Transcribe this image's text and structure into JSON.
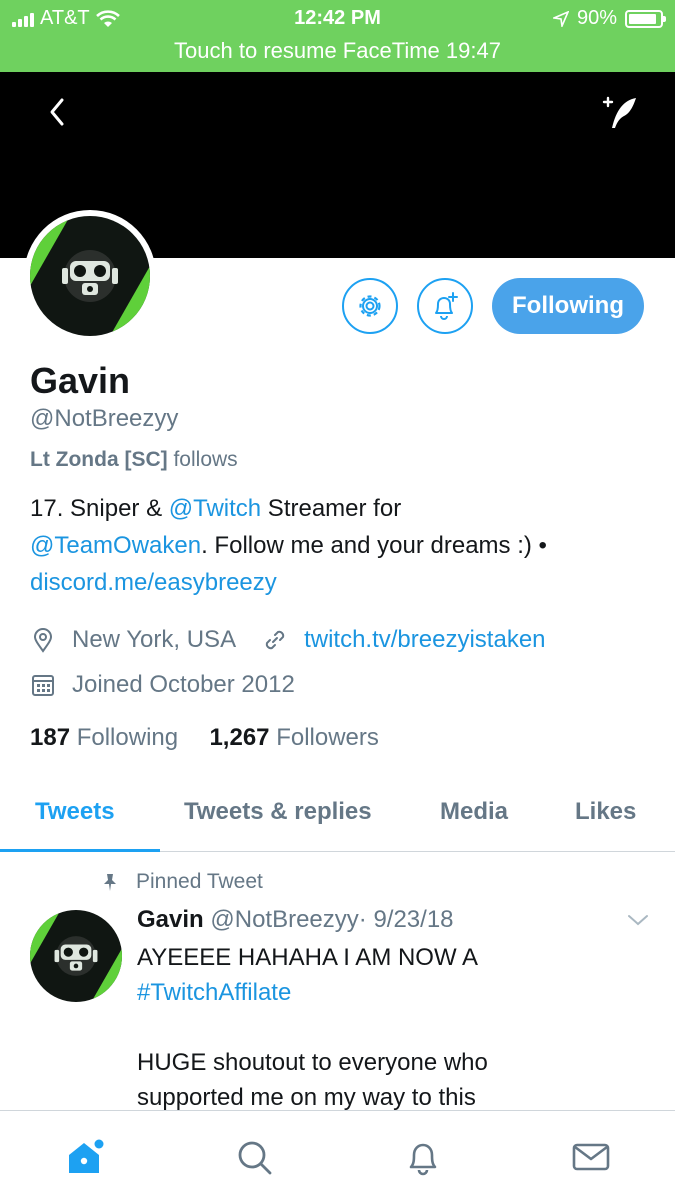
{
  "status": {
    "carrier": "AT&T",
    "time": "12:42 PM",
    "battery": "90%",
    "battery_level": 0.9,
    "facetime": "Touch to resume FaceTime 19:47"
  },
  "profile": {
    "name": "Gavin",
    "handle": "@NotBreezyy",
    "followed_by_name": "Lt Zonda [SC]",
    "followed_by_suffix": " follows",
    "follow_button": "Following",
    "bio": {
      "p1": "17. Sniper & ",
      "link1": "@Twitch",
      "p2": " Streamer for",
      "link2": "@TeamOwaken",
      "p3": ". Follow me and your dreams :) •",
      "link3": "discord.me/easybreezy"
    },
    "location": "New York, USA",
    "website": "twitch.tv/breezyistaken",
    "joined": "Joined October 2012",
    "following_count": "187",
    "following_label": "Following",
    "followers_count": "1,267",
    "followers_label": "Followers"
  },
  "tabs": [
    "Tweets",
    "Tweets & replies",
    "Media",
    "Likes"
  ],
  "tweet": {
    "pinned_label": "Pinned Tweet",
    "author": "Gavin",
    "handle": "@NotBreezyy",
    "date": "· 9/23/18",
    "line1": "AYEEEE HAHAHA I AM NOW A",
    "hashtag": "#TwitchAffilate",
    "line3": "HUGE shoutout to everyone who",
    "line4": "supported me on my way to this"
  },
  "colors": {
    "accent": "#1da1f2",
    "status_bar": "#6fd15f",
    "avatar_green": "#5fd03a"
  }
}
